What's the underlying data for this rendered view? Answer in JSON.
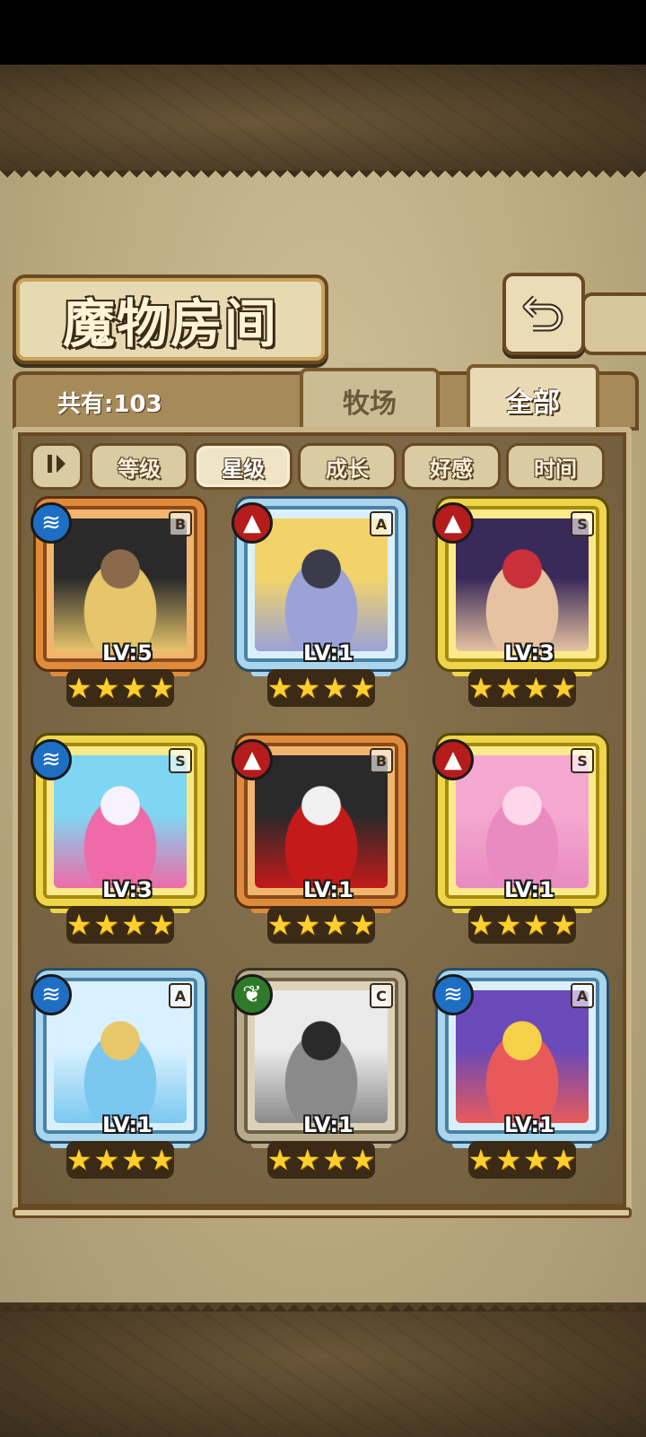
{
  "header": {
    "title": "魔物房间",
    "back_icon": "back-arrow-icon"
  },
  "summary": {
    "count_label": "共有:103"
  },
  "tabs": [
    {
      "label": "牧场",
      "selected": false
    },
    {
      "label": "全部",
      "selected": true
    }
  ],
  "sort": {
    "icon": "sort-toggle-icon",
    "options": [
      {
        "label": "等级",
        "selected": false
      },
      {
        "label": "星级",
        "selected": true
      },
      {
        "label": "成长",
        "selected": false
      },
      {
        "label": "好感",
        "selected": false
      },
      {
        "label": "时间",
        "selected": false
      }
    ]
  },
  "monsters": [
    {
      "element": "water",
      "rank": "B",
      "level": "LV:5",
      "stars": 4,
      "frame": "bronze",
      "palette": [
        "#2a2a2a",
        "#e7c56a",
        "#8a6a4a"
      ]
    },
    {
      "element": "fire",
      "rank": "A",
      "level": "LV:1",
      "stars": 4,
      "frame": "silver",
      "palette": [
        "#f2d36a",
        "#9aa2d6",
        "#3a3a4a"
      ]
    },
    {
      "element": "fire",
      "rank": "S",
      "level": "LV:3",
      "stars": 4,
      "frame": "gold",
      "palette": [
        "#3a2a5a",
        "#e6c2a0",
        "#c9303a"
      ]
    },
    {
      "element": "water",
      "rank": "S",
      "level": "LV:3",
      "stars": 4,
      "frame": "gold",
      "palette": [
        "#7fd6f2",
        "#ef6aa8",
        "#f7f2ff"
      ]
    },
    {
      "element": "fire",
      "rank": "B",
      "level": "LV:1",
      "stars": 4,
      "frame": "bronze",
      "palette": [
        "#2a2a2a",
        "#c41a1a",
        "#f0f0f0"
      ]
    },
    {
      "element": "fire",
      "rank": "S",
      "level": "LV:1",
      "stars": 4,
      "frame": "gold",
      "palette": [
        "#f4a8d0",
        "#e98ac0",
        "#ffd6ea"
      ]
    },
    {
      "element": "water",
      "rank": "A",
      "level": "LV:1",
      "stars": 4,
      "frame": "silver",
      "palette": [
        "#d8f0ff",
        "#7ac8f0",
        "#e8c76a"
      ]
    },
    {
      "element": "wood",
      "rank": "C",
      "level": "LV:1",
      "stars": 4,
      "frame": "stone",
      "palette": [
        "#eaeaea",
        "#8a8a8a",
        "#2a2a2a"
      ]
    },
    {
      "element": "water",
      "rank": "A",
      "level": "LV:1",
      "stars": 4,
      "frame": "silver",
      "palette": [
        "#6a4ab8",
        "#e85a5a",
        "#f7d04a"
      ]
    }
  ],
  "element_icons": {
    "water": "water-element-icon",
    "fire": "fire-element-icon",
    "wood": "wood-element-icon"
  }
}
